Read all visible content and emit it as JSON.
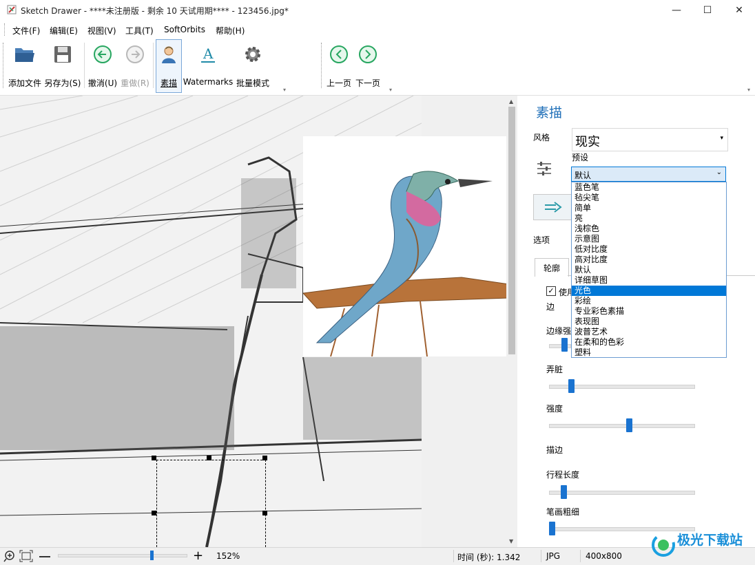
{
  "window": {
    "title": "Sketch Drawer - ****未注册版 - 剩余 10 天试用期**** - 123456.jpg*",
    "minimize": "—",
    "maximize": "☐",
    "close": "✕"
  },
  "menu": [
    "文件(F)",
    "编辑(E)",
    "视图(V)",
    "工具(T)",
    "SoftOrbits",
    "帮助(H)"
  ],
  "toolbar": {
    "add_file": "添加文件",
    "save_as": "另存为(S)",
    "undo": "撤消(U)",
    "redo": "重做(R)",
    "sketch": "素描",
    "watermarks": "Watermarks",
    "batch": "批量模式",
    "prev": "上一页",
    "next": "下一页"
  },
  "panel": {
    "title": "素描",
    "style_label": "风格",
    "style_value": "现实",
    "preset_label": "预设",
    "preset_value": "默认",
    "options_label": "选项",
    "tab_outline": "轮廓",
    "use_checkbox_label": "使用",
    "edge_label": "边",
    "edge_strength_label": "边缘强",
    "dirty_label": "弄脏",
    "intensity_label": "强度",
    "stroke_label": "描边",
    "stroke_length_label": "行程长度",
    "stroke_width_label": "笔画粗细",
    "use_checked": true
  },
  "preset_options": [
    "蓝色笔",
    "毡尖笔",
    "简单",
    "亮",
    "浅棕色",
    "示意图",
    "低对比度",
    "高对比度",
    "默认",
    "详细草图",
    "光色",
    "彩绘",
    "专业彩色素描",
    "表现图",
    "波普艺术",
    "在柔和的色彩",
    "塑料"
  ],
  "preset_selected": "光色",
  "sliders": {
    "dirty": 0.15,
    "intensity": 0.55,
    "stroke_length": 0.1,
    "stroke_width": 0.02
  },
  "status": {
    "zoom": "152%",
    "time": "时间 (秒): 1.342",
    "format": "JPG",
    "size": "400x800"
  },
  "watermark_text": "极光下载站",
  "colors": {
    "accent": "#1a73d0",
    "selection": "#0078d7",
    "panel_title": "#1f6fb8",
    "arrow": "#e02020"
  }
}
